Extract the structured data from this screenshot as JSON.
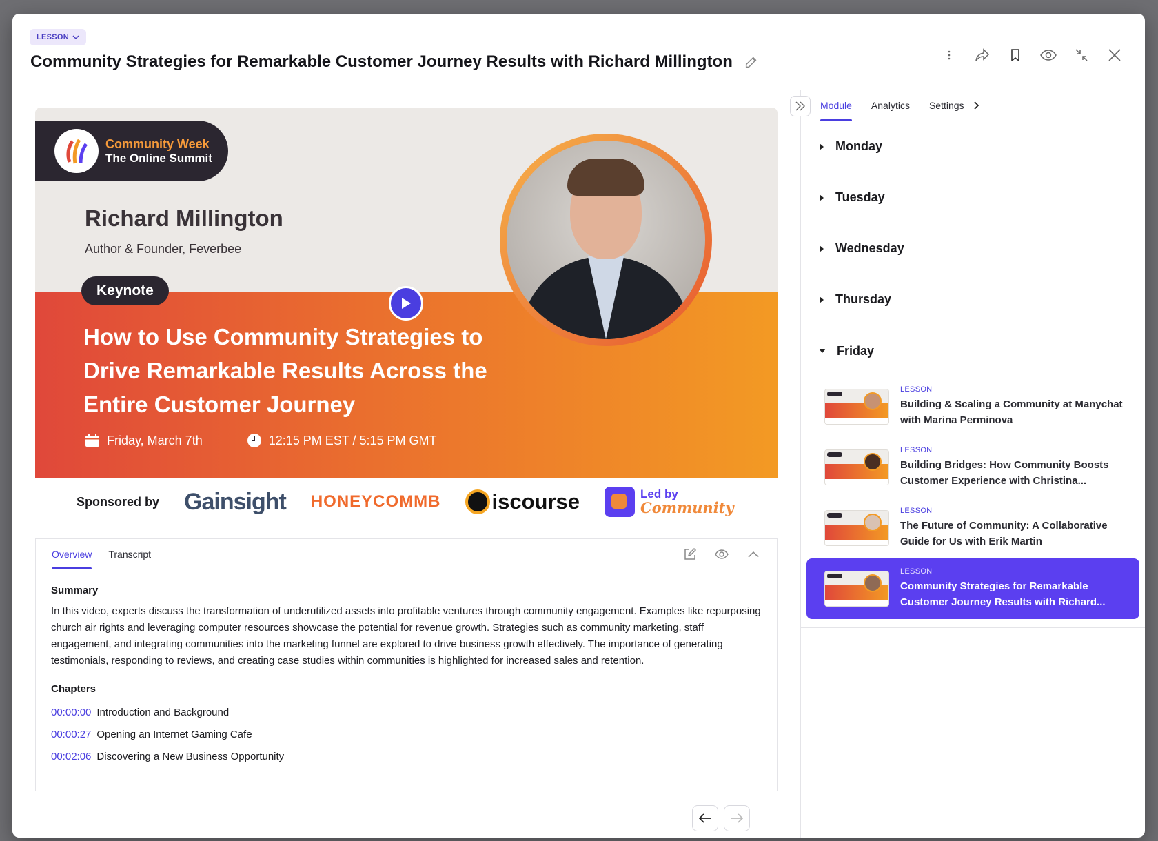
{
  "header": {
    "badge": "LESSON",
    "title": "Community Strategies for Remarkable Customer Journey Results with Richard Millington"
  },
  "video": {
    "logo_line1": "Community Week",
    "logo_line2": "The Online Summit",
    "speaker_name": "Richard Millington",
    "speaker_role": "Author & Founder, Feverbee",
    "session_type": "Keynote",
    "headline": "How to Use Community Strategies to Drive Remarkable Results Across the Entire Customer Journey",
    "date": "Friday, March 7th",
    "time": "12:15 PM EST / 5:15 PM GMT",
    "sponsored_by": "Sponsored by",
    "sponsors": [
      "Gainsight",
      "HONEYCOMMB",
      "iscourse",
      "Led by",
      "Community"
    ]
  },
  "content_tabs": {
    "overview": "Overview",
    "transcript": "Transcript"
  },
  "summary": {
    "heading": "Summary",
    "text": "In this video, experts discuss the transformation of underutilized assets into profitable ventures through community engagement. Examples like repurposing church air rights and leveraging computer resources showcase the potential for revenue growth. Strategies such as community marketing, staff engagement, and integrating communities into the marketing funnel are explored to drive business growth effectively. The importance of generating testimonials, responding to reviews, and creating case studies within communities is highlighted for increased sales and retention."
  },
  "chapters": {
    "heading": "Chapters",
    "items": [
      {
        "time": "00:00:00",
        "title": "Introduction and Background"
      },
      {
        "time": "00:00:27",
        "title": "Opening an Internet Gaming Cafe"
      },
      {
        "time": "00:02:06",
        "title": "Discovering a New Business Opportunity"
      }
    ]
  },
  "sidebar": {
    "tabs": [
      "Module",
      "Analytics",
      "Settings"
    ],
    "days": [
      "Monday",
      "Tuesday",
      "Wednesday",
      "Thursday"
    ],
    "open_day": "Friday",
    "lessons": [
      {
        "tag": "LESSON",
        "title": "Building & Scaling a Community at Manychat with Marina Perminova"
      },
      {
        "tag": "LESSON",
        "title": "Building Bridges: How Community Boosts Customer Experience with Christina..."
      },
      {
        "tag": "LESSON",
        "title": "The Future of Community: A Collaborative Guide for Us with Erik Martin"
      },
      {
        "tag": "LESSON",
        "title": "Community Strategies for Remarkable Customer Journey Results with Richard..."
      }
    ]
  },
  "colors": {
    "accent": "#4a3ee0",
    "active_lesson": "#5b3ff0"
  }
}
